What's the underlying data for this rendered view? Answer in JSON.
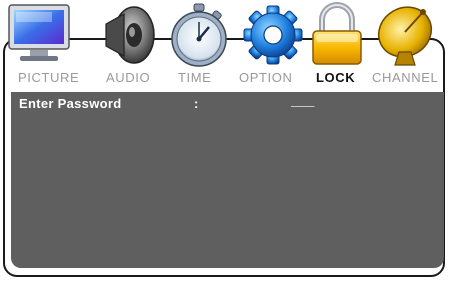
{
  "menu": {
    "tabs": [
      {
        "label": "PICTURE",
        "icon": "monitor-icon"
      },
      {
        "label": "AUDIO",
        "icon": "speaker-icon"
      },
      {
        "label": "TIME",
        "icon": "stopwatch-icon"
      },
      {
        "label": "OPTION",
        "icon": "gear-icon"
      },
      {
        "label": "LOCK",
        "icon": "padlock-icon",
        "active": true
      },
      {
        "label": "CHANNEL",
        "icon": "satellite-dish-icon"
      }
    ]
  },
  "lock": {
    "label": "Enter Password",
    "colon": ":",
    "value": "___"
  },
  "colors": {
    "panel": "#5f5f5f",
    "active_tab": "#111111",
    "inactive_tab": "#9a9a9a"
  }
}
